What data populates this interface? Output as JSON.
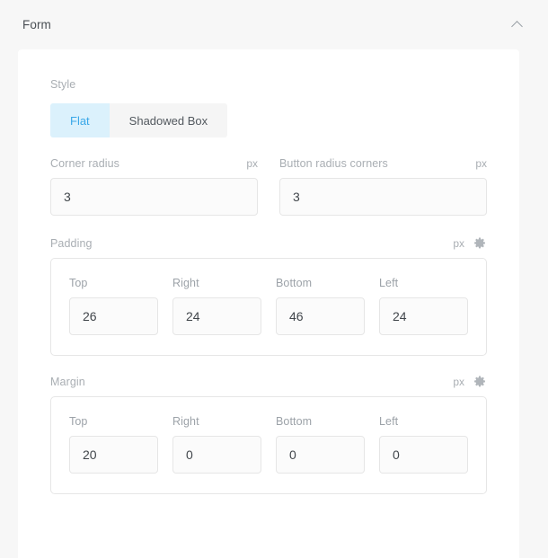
{
  "panel": {
    "title": "Form",
    "collapse_icon": "chevron-up-icon"
  },
  "style_section": {
    "label": "Style",
    "options": [
      {
        "label": "Flat",
        "selected": true
      },
      {
        "label": "Shadowed Box",
        "selected": false
      }
    ],
    "active_bg": "#dbf1fc",
    "active_color": "#3aa8e8"
  },
  "radius": {
    "corner": {
      "label": "Corner radius",
      "unit": "px",
      "value": "3"
    },
    "button": {
      "label": "Button radius corners",
      "unit": "px",
      "value": "3"
    }
  },
  "padding": {
    "label": "Padding",
    "unit": "px",
    "settings_icon": "gear-icon",
    "fields": [
      {
        "label": "Top",
        "value": "26"
      },
      {
        "label": "Right",
        "value": "24"
      },
      {
        "label": "Bottom",
        "value": "46"
      },
      {
        "label": "Left",
        "value": "24"
      }
    ]
  },
  "margin": {
    "label": "Margin",
    "unit": "px",
    "settings_icon": "gear-icon",
    "fields": [
      {
        "label": "Top",
        "value": "20"
      },
      {
        "label": "Right",
        "value": "0"
      },
      {
        "label": "Bottom",
        "value": "0"
      },
      {
        "label": "Left",
        "value": "0"
      }
    ]
  }
}
